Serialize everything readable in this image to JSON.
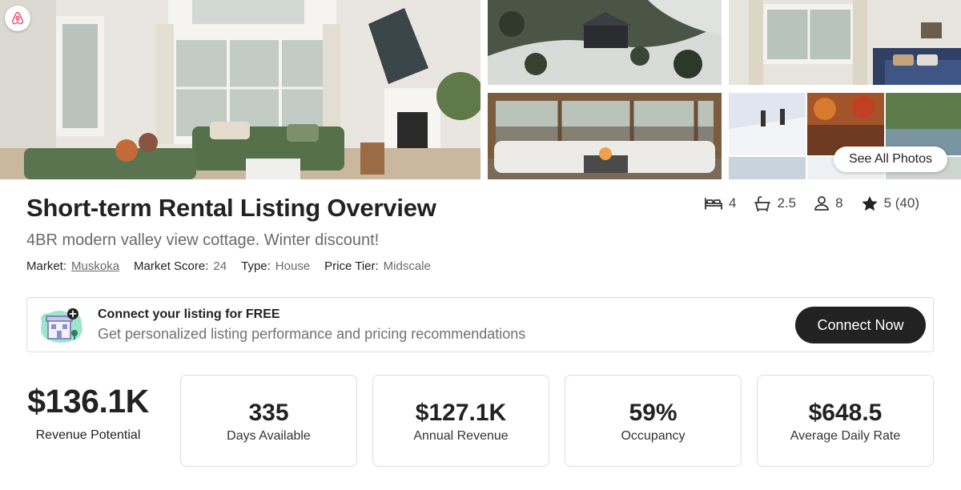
{
  "gallery": {
    "see_all_label": "See All Photos",
    "photos": [
      "living-room",
      "aerial-view",
      "bedroom",
      "screened-deck",
      "activities-collage"
    ]
  },
  "listing": {
    "title": "Short-term Rental Listing Overview",
    "subtitle": "4BR modern valley view cottage. Winter discount!",
    "meta": {
      "market_label": "Market:",
      "market_value": "Muskoka",
      "score_label": "Market Score:",
      "score_value": "24",
      "type_label": "Type:",
      "type_value": "House",
      "tier_label": "Price Tier:",
      "tier_value": "Midscale"
    },
    "stats": {
      "bedrooms": "4",
      "bathrooms": "2.5",
      "guests": "8",
      "rating": "5 (40)"
    }
  },
  "banner": {
    "title": "Connect your listing for FREE",
    "subtitle": "Get personalized listing performance and pricing recommendations",
    "button_label": "Connect Now"
  },
  "metrics": {
    "hero": {
      "value": "$136.1K",
      "label": "Revenue Potential"
    },
    "cards": [
      {
        "value": "335",
        "label": "Days Available"
      },
      {
        "value": "$127.1K",
        "label": "Annual Revenue"
      },
      {
        "value": "59%",
        "label": "Occupancy"
      },
      {
        "value": "$648.5",
        "label": "Average Daily Rate"
      }
    ]
  },
  "colors": {
    "brand": "#FF385C",
    "text": "#222222",
    "muted": "#6A6A6A",
    "button": "#222222",
    "border": "#DDDDDD"
  }
}
